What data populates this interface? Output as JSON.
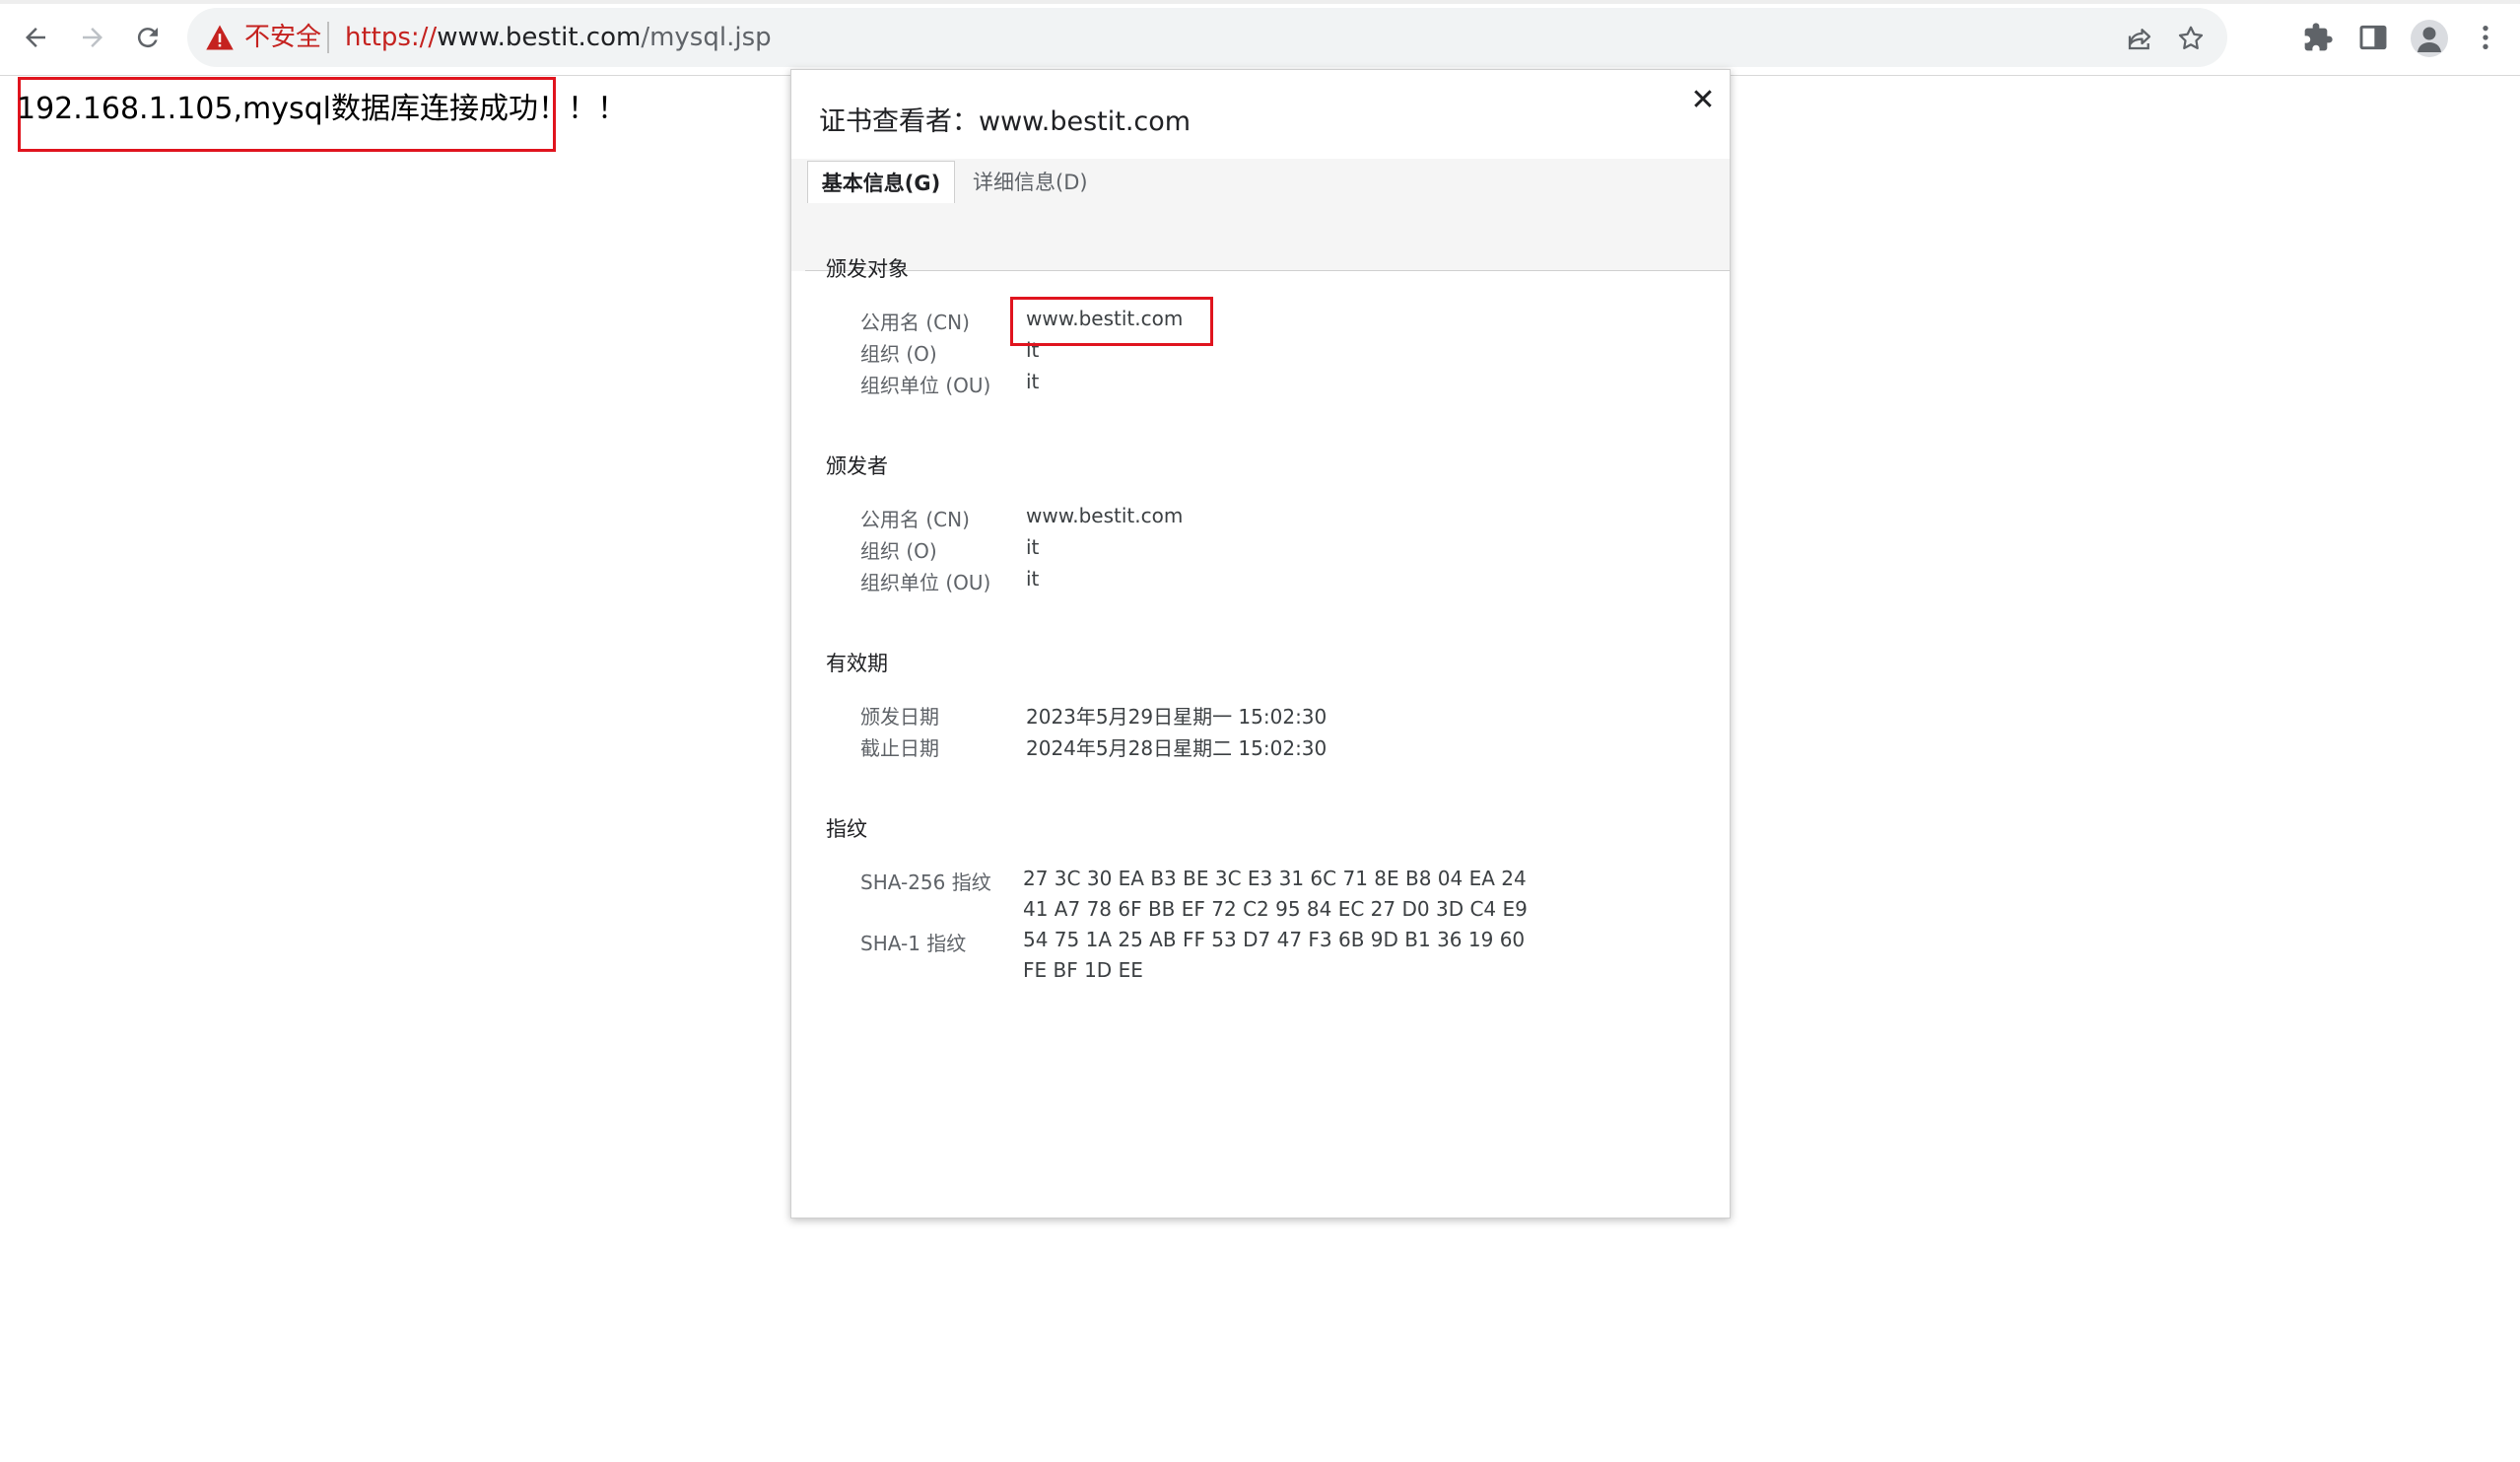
{
  "browser": {
    "security_label": "不安全",
    "url_scheme": "https://",
    "url_host": "www.bestit.com",
    "url_path": "/mysql.jsp"
  },
  "page": {
    "message": "192.168.1.105,mysql数据库连接成功！！！"
  },
  "dialog": {
    "title": "证书查看者：www.bestit.com",
    "close_label": "✕",
    "tabs": {
      "basic": "基本信息(G)",
      "details": "详细信息(D)"
    },
    "issued_to": {
      "heading": "颁发对象",
      "cn_label": "公用名 (CN)",
      "cn_value": "www.bestit.com",
      "o_label": "组织 (O)",
      "o_value": "it",
      "ou_label": "组织单位 (OU)",
      "ou_value": "it"
    },
    "issued_by": {
      "heading": "颁发者",
      "cn_label": "公用名 (CN)",
      "cn_value": "www.bestit.com",
      "o_label": "组织 (O)",
      "o_value": "it",
      "ou_label": "组织单位 (OU)",
      "ou_value": "it"
    },
    "validity": {
      "heading": "有效期",
      "issued_label": "颁发日期",
      "issued_value": "2023年5月29日星期一 15:02:30",
      "expires_label": "截止日期",
      "expires_value": "2024年5月28日星期二 15:02:30"
    },
    "fingerprints": {
      "heading": "指纹",
      "sha256_label": "SHA-256 指纹",
      "sha256_line1": "27 3C 30 EA B3 BE 3C E3 31 6C 71 8E B8 04 EA 24",
      "sha256_line2": "41 A7 78 6F BB EF 72 C2 95 84 EC 27 D0 3D C4 E9",
      "sha1_label": "SHA-1 指纹",
      "sha1_line1": "54 75 1A 25 AB FF 53 D7 47 F3 6B 9D B1 36 19 60",
      "sha1_line2": "FE BF 1D EE"
    }
  },
  "colors": {
    "annotation_red": "#e0141e",
    "insecure_red": "#c5221f"
  }
}
